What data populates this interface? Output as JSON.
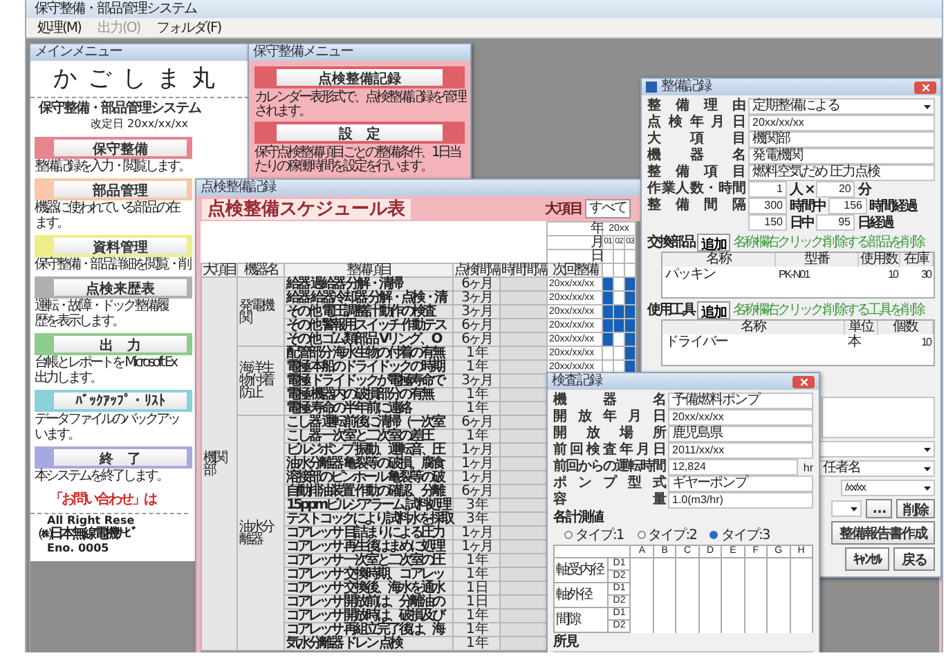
{
  "app": {
    "title": "保守整備・部品管理システム",
    "menu": [
      {
        "label": "処理(M)",
        "disabled": false
      },
      {
        "label": "出力(O)",
        "disabled": true
      },
      {
        "label": "フォルダ(F)",
        "disabled": false
      }
    ]
  },
  "main_menu": {
    "title": "メインメニュー",
    "ship_name": "かごしま丸",
    "system_name": "保守整備・部品管理システム",
    "revised": "改定日 20xx/xx/xx",
    "items": [
      {
        "label": "保守整備",
        "color": "#e8848e",
        "desc": [
          "整備記録を入力・閲覧します。"
        ]
      },
      {
        "label": "部品管理",
        "color": "#f8c8a8",
        "desc": [
          "機器に使われている部品の在",
          "ます。"
        ]
      },
      {
        "label": "資料管理",
        "color": "#eeee88",
        "desc": [
          "保守整備・部品詳細を閲覧・削"
        ]
      },
      {
        "label": "点検来歴表",
        "color": "#b0b0b0",
        "desc": [
          "運転・故障・ドック整備履",
          "歴を表示します。"
        ]
      },
      {
        "label": "出　力",
        "color": "#8ccc8c",
        "desc": [
          "台帳とレポートを Microsoft Ex",
          "出力します。"
        ]
      },
      {
        "label": "ﾊﾞｯｸｱｯﾌﾟ・ﾘｽﾄ",
        "color": "#8cd0d8",
        "desc": [
          "データファイルのバックアッ",
          "います。"
        ]
      },
      {
        "label": "終　了",
        "color": "#a8a8e0",
        "desc": [
          "本システムを終了します。"
        ]
      }
    ],
    "notice": "「お問い合わせ」は",
    "footer": [
      "All Right Rese",
      "㈱日本無線電機ｻｰﾋﾞ",
      "Eno. 0005"
    ]
  },
  "maintenance_menu": {
    "title": "保守整備メニュー",
    "items": [
      {
        "label": "点検整備記録",
        "desc": "カレンダー表形式で、点検整備記録を管理されます。"
      },
      {
        "label": "設　定",
        "desc": "保守点検整備項目ごとの整備条件、1日当たりの稼働時間を設定を行います。"
      }
    ]
  },
  "schedule": {
    "title": "点検整備記録",
    "heading": "点検整備スケジュール表",
    "filter": {
      "label": "大項目",
      "value": "すべて"
    },
    "calendar": {
      "year_label": "年",
      "month_label": "月",
      "day_label": "日",
      "year": "20xx",
      "months": [
        "01",
        "02",
        "03"
      ]
    },
    "columns": [
      "大項目",
      "機器名",
      "整備項目",
      "点検間隔",
      "時間間隔",
      "次回整備"
    ],
    "groups": [
      {
        "name": "機関部",
        "equipment": [
          {
            "name": "発電機関",
            "rows": [
              {
                "item": "給器 過給器 分解・清掃",
                "interval": "6ヶ月",
                "next": "20xx/xx/xx",
                "plan": [
                  true,
                  false,
                  true
                ]
              },
              {
                "item": "給器 給器冷却器 分解・点検・清",
                "interval": "3ヶ月",
                "next": "20xx/xx/xx",
                "plan": [
                  true,
                  false,
                  true
                ]
              },
              {
                "item": "その他 電圧調整計 動作の検査",
                "interval": "3ヶ月",
                "next": "20xx/xx/xx",
                "plan": [
                  true,
                  true,
                  true
                ]
              },
              {
                "item": "その他 警報用スイッチ 作動テス",
                "interval": "6ヶ月",
                "next": "20xx/xx/xx",
                "plan": [
                  true,
                  true,
                  true
                ]
              },
              {
                "item": "その他 ゴム類部品 Vリング、O",
                "interval": "6ヶ月",
                "next": "20xx/xx/xx",
                "plan": [
                  true,
                  false,
                  true
                ]
              }
            ]
          },
          {
            "name": "海洋生物付着防止",
            "rows": [
              {
                "item": "配管部分 海水生物の付着の有無",
                "interval": "1 年",
                "next": "20xx/xx/xx",
                "plan": [
                  false,
                  false,
                  true
                ]
              },
              {
                "item": "電極 本船のドライドックの時期",
                "interval": "1 年",
                "next": "20xx/xx/xx",
                "plan": [
                  false,
                  false,
                  true
                ]
              },
              {
                "item": "電極 ドライドックが電極寿命で",
                "interval": "3ヶ月"
              },
              {
                "item": "電極 機器内の破損部分の有無",
                "interval": "1 年"
              },
              {
                "item": "電極 寿命の半年前に連絡",
                "interval": "1 年"
              }
            ]
          },
          {
            "name": "油水分離器",
            "rows": [
              {
                "item": "こし器 運転前後に清掃（一次室",
                "interval": "6ヶ月"
              },
              {
                "item": "こし器 一次室と二次室の差圧",
                "interval": "1 年"
              },
              {
                "item": "ビルジポンプ 振動、運転音、圧",
                "interval": "1ヶ月"
              },
              {
                "item": "油水分離器 亀裂等の破損、腐食",
                "interval": "1ヶ月"
              },
              {
                "item": "溶接部のピンホール 亀裂等の破",
                "interval": "1ヶ月"
              },
              {
                "item": "自動排油装置 作動の確認、分離",
                "interval": "6ヶ月"
              },
              {
                "item": "15ppmビルジアラーム 試料処理",
                "interval": "3 年"
              },
              {
                "item": "テストコックにより試料水を採取",
                "interval": "3 年"
              },
              {
                "item": "コアレッサ 目詰まりによる圧力",
                "interval": "1ヶ月"
              },
              {
                "item": "コアレッサ 再生後はまめに処理",
                "interval": "1ヶ月"
              },
              {
                "item": "コアレッサ 一次室と二次室の圧",
                "interval": "1 年"
              },
              {
                "item": "コアレッサ 交換時期、コアレッ",
                "interval": "1 年"
              },
              {
                "item": "コアレッサ 交換後、海水を通水",
                "interval": "1 日"
              },
              {
                "item": "コアレッサ 開放前は、分離油の",
                "interval": "1 日"
              },
              {
                "item": "コアレッサ 開放時は、破損及び",
                "interval": "1 年"
              },
              {
                "item": "コアレッサ 再組立完了後は、海",
                "interval": "1 年"
              },
              {
                "item": "気水分離器 ドレン 点検",
                "interval": "1 年"
              }
            ]
          }
        ]
      }
    ]
  },
  "record": {
    "title": "整備記録",
    "fields": [
      {
        "label": "整備理由",
        "kind": "dropdown",
        "value": "定期整備による"
      },
      {
        "label": "点検年月日",
        "kind": "text",
        "value": "20xx/xx/xx"
      },
      {
        "label": "大項目",
        "kind": "text",
        "value": "機関部"
      },
      {
        "label": "機器名",
        "kind": "text",
        "value": "発電機関"
      },
      {
        "label": "整備項目",
        "kind": "text",
        "value": "燃料空気だめ 圧力点検"
      },
      {
        "label": "作業人数・時間",
        "kind": "units",
        "rows": [
          [
            {
              "value": "1"
            },
            {
              "text": "人 ×"
            },
            {
              "value": "20"
            },
            {
              "text": "分"
            }
          ]
        ]
      },
      {
        "label": "整備間隔",
        "kind": "units",
        "rows": [
          [
            {
              "value": "300"
            },
            {
              "text": "時間中"
            },
            {
              "value": "156"
            },
            {
              "text": "時間経過"
            }
          ],
          [
            {
              "value": "150"
            },
            {
              "text": "日中"
            },
            {
              "value": "95"
            },
            {
              "text": "日経過"
            }
          ]
        ]
      }
    ],
    "lists": [
      {
        "label": "交換部品",
        "add_button": "追加",
        "hint": "名称欄右クリック:削除する部品を削除",
        "columns": [
          "名称",
          "型番",
          "使用数",
          "在庫"
        ],
        "rows": [
          [
            "パッキン",
            "PK-N01",
            "10",
            "30"
          ]
        ]
      },
      {
        "label": "使用工具",
        "add_button": "追加",
        "hint": "名称欄右クリック:削除する工具を削除",
        "columns": [
          "名称",
          "単位",
          "個数"
        ],
        "rows": [
          [
            "ドライバー",
            "本",
            "10"
          ]
        ]
      }
    ],
    "manager": "任者名",
    "date": "/xx/xx",
    "more_button": "…",
    "delete_button": "削除",
    "report_button": "整備報告書作成",
    "cancel_button": "ｷｬﾝｾﾙ",
    "back_button": "戻る"
  },
  "inspection": {
    "title": "検査記録",
    "fields": [
      {
        "label": "機器名",
        "value": "予備燃料ポンプ"
      },
      {
        "label": "開放年月日",
        "value": "20xx/xx/xx"
      },
      {
        "label": "開放場所",
        "value": "鹿児島県"
      },
      {
        "label": "前回検査年月日",
        "value": "2011/xx/xx"
      },
      {
        "label": "前回からの運転時間",
        "value": "12,824",
        "unit": "hr"
      },
      {
        "label": "ポンプ型式",
        "value": "ギヤーポンプ"
      },
      {
        "label": "容量",
        "value": "1.0(m3/hr)"
      }
    ],
    "measure_label": "各計測値",
    "types": [
      {
        "label": "タイプ:1",
        "selected": false
      },
      {
        "label": "タイプ:2",
        "selected": false
      },
      {
        "label": "タイプ:3",
        "selected": true
      }
    ],
    "grid": {
      "columns": [
        "A",
        "B",
        "C",
        "D",
        "E",
        "F",
        "G",
        "H"
      ],
      "groups": [
        {
          "name": "軸受内径",
          "subs": [
            "D1",
            "D2"
          ]
        },
        {
          "name": "軸外径",
          "subs": [
            "D1",
            "D2"
          ]
        },
        {
          "name": "間隙",
          "subs": [
            "D1",
            "D2"
          ]
        }
      ]
    },
    "remarks_label": "所見"
  }
}
